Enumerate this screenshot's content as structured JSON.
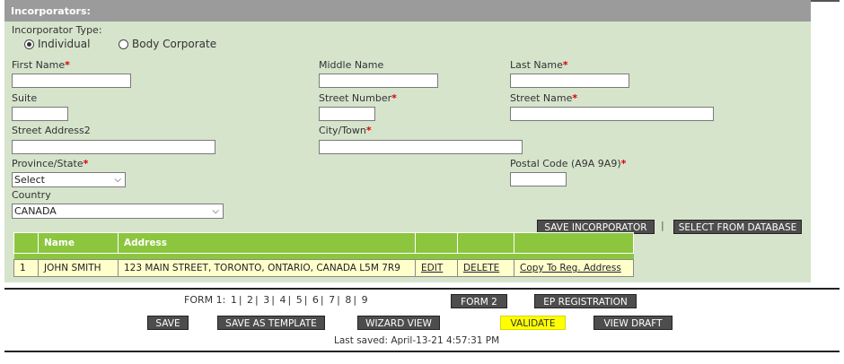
{
  "section": {
    "title": "Incorporators:"
  },
  "incorporator_type": {
    "label": "Incorporator Type:",
    "options": [
      "Individual",
      "Body Corporate"
    ],
    "selected": "Individual"
  },
  "fields": {
    "first_name": {
      "label": "First Name",
      "value": ""
    },
    "middle_name": {
      "label": "Middle Name",
      "value": ""
    },
    "last_name": {
      "label": "Last Name",
      "value": ""
    },
    "suite": {
      "label": "Suite",
      "value": ""
    },
    "street_number": {
      "label": "Street Number",
      "value": ""
    },
    "street_name": {
      "label": "Street Name",
      "value": ""
    },
    "street_address2": {
      "label": "Street Address2",
      "value": ""
    },
    "city": {
      "label": "City/Town",
      "value": ""
    },
    "province": {
      "label": "Province/State",
      "value": "Select"
    },
    "postal_code": {
      "label": "Postal Code (A9A 9A9)",
      "value": ""
    },
    "country": {
      "label": "Country",
      "value": "CANADA"
    }
  },
  "required_mark": "*",
  "buttons": {
    "save_incorporator": "SAVE INCORPORATOR",
    "divider": "|",
    "select_from_db": "SELECT FROM DATABASE",
    "form2": "FORM 2",
    "ep_registration": "EP REGISTRATION",
    "save": "SAVE",
    "save_as_template": "SAVE AS TEMPLATE",
    "wizard_view": "WIZARD VIEW",
    "validate": "VALIDATE",
    "view_draft": "VIEW DRAFT"
  },
  "table": {
    "headers": [
      "",
      "Name",
      "Address",
      "",
      "",
      ""
    ],
    "rows": [
      {
        "num": "1",
        "name": "JOHN SMITH",
        "address": "123 MAIN STREET, TORONTO, ONTARIO, CANADA L5M 7R9",
        "edit": "EDIT",
        "delete": "DELETE",
        "copy": "Copy To Reg. Address"
      }
    ]
  },
  "form_nav": {
    "label": "FORM 1:",
    "pages": [
      "1",
      "2",
      "3",
      "4",
      "5",
      "6",
      "7",
      "8",
      "9"
    ],
    "separator": "|"
  },
  "status": {
    "last_saved": "Last saved: April-13-21 4:57:31 PM"
  },
  "colors": {
    "header_bg": "#9b9b9b",
    "panel_bg": "#d6e4cc",
    "table_header": "#8cc63f",
    "row_bg": "#ffffcc",
    "highlight": "#ffff00"
  }
}
